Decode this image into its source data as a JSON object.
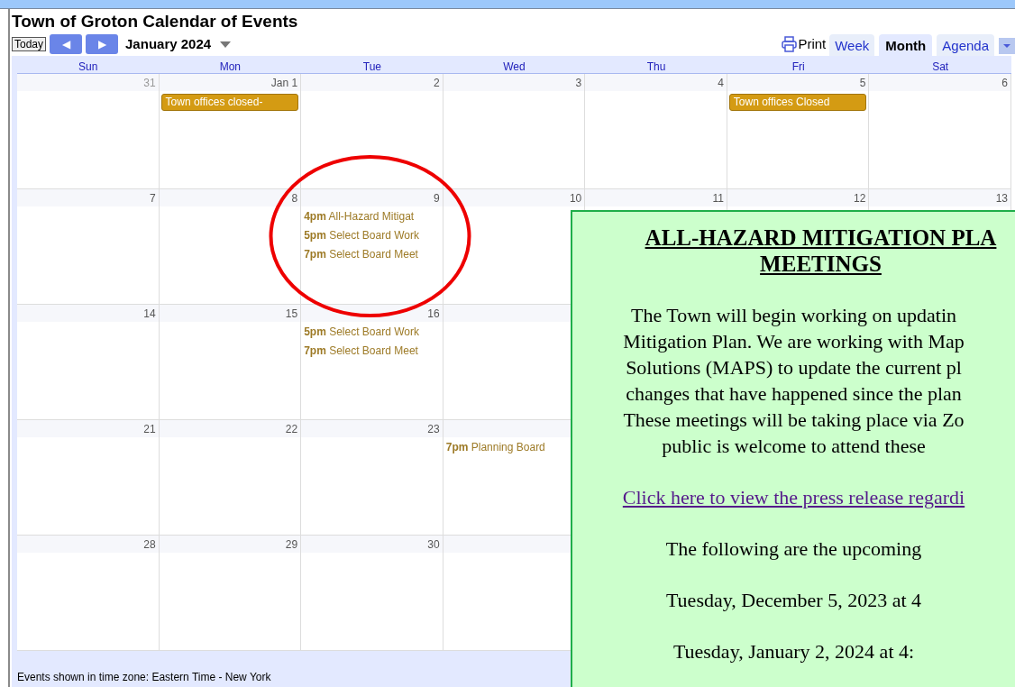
{
  "title": "Town of Groton Calendar of Events",
  "toolbar": {
    "today": "Today",
    "prev": "◀",
    "next": "▶",
    "month": "January 2024",
    "print": "Print"
  },
  "view_tabs": [
    {
      "label": "Week",
      "selected": false
    },
    {
      "label": "Month",
      "selected": true
    },
    {
      "label": "Agenda",
      "selected": false
    }
  ],
  "weekdays": [
    "Sun",
    "Mon",
    "Tue",
    "Wed",
    "Thu",
    "Fri",
    "Sat"
  ],
  "weeks": [
    {
      "days": [
        {
          "date": "31",
          "other_month": true
        },
        {
          "date": "Jan 1",
          "other_month": false,
          "events": [
            {
              "kind": "allday",
              "title": "Town offices closed-"
            }
          ]
        },
        {
          "date": "2",
          "other_month": false
        },
        {
          "date": "3",
          "other_month": false
        },
        {
          "date": "4",
          "other_month": false
        },
        {
          "date": "5",
          "other_month": false,
          "events": [
            {
              "kind": "allday",
              "title": "Town offices Closed"
            }
          ]
        },
        {
          "date": "6",
          "other_month": false
        }
      ]
    },
    {
      "days": [
        {
          "date": "7",
          "other_month": false
        },
        {
          "date": "8",
          "other_month": false
        },
        {
          "date": "9",
          "other_month": false,
          "events": [
            {
              "kind": "timed",
              "time": "4pm",
              "title": "All-Hazard Mitigat"
            },
            {
              "kind": "timed",
              "time": "5pm",
              "title": "Select Board Work"
            },
            {
              "kind": "timed",
              "time": "7pm",
              "title": "Select Board Meet"
            }
          ]
        },
        {
          "date": "10",
          "other_month": false
        },
        {
          "date": "11",
          "other_month": false
        },
        {
          "date": "12",
          "other_month": false
        },
        {
          "date": "13",
          "other_month": false
        }
      ]
    },
    {
      "days": [
        {
          "date": "14",
          "other_month": false
        },
        {
          "date": "15",
          "other_month": false
        },
        {
          "date": "16",
          "other_month": false,
          "events": [
            {
              "kind": "timed",
              "time": "5pm",
              "title": "Select Board Work"
            },
            {
              "kind": "timed",
              "time": "7pm",
              "title": "Select Board Meet"
            }
          ]
        }
      ]
    },
    {
      "days": [
        {
          "date": "21",
          "other_month": false
        },
        {
          "date": "22",
          "other_month": false
        },
        {
          "date": "23",
          "other_month": false
        },
        {
          "events": [
            {
              "kind": "timed",
              "time": "7pm",
              "title": "Planning Board"
            }
          ]
        }
      ]
    },
    {
      "days": [
        {
          "date": "28",
          "other_month": false
        },
        {
          "date": "29",
          "other_month": false
        },
        {
          "date": "30",
          "other_month": false
        }
      ]
    }
  ],
  "footer": "Events shown in time zone: Eastern Time - New York",
  "popup": {
    "heading_lines": [
      "ALL-HAZARD MITIGATION PLA",
      "MEETINGS"
    ],
    "paragraph_lines": [
      "The Town will begin working on updatin",
      "Mitigation Plan. We are working with Map",
      "Solutions (MAPS) to update the current pl",
      "changes that have happened since the plan",
      "These meetings will be taking place via Zo",
      "public is welcome to attend these"
    ],
    "link": "Click here to view the press release regardi",
    "intro": "The following are the upcoming",
    "meetings": [
      "Tuesday, December 5, 2023 at 4",
      "Tuesday, January 2, 2024 at 4:"
    ]
  }
}
